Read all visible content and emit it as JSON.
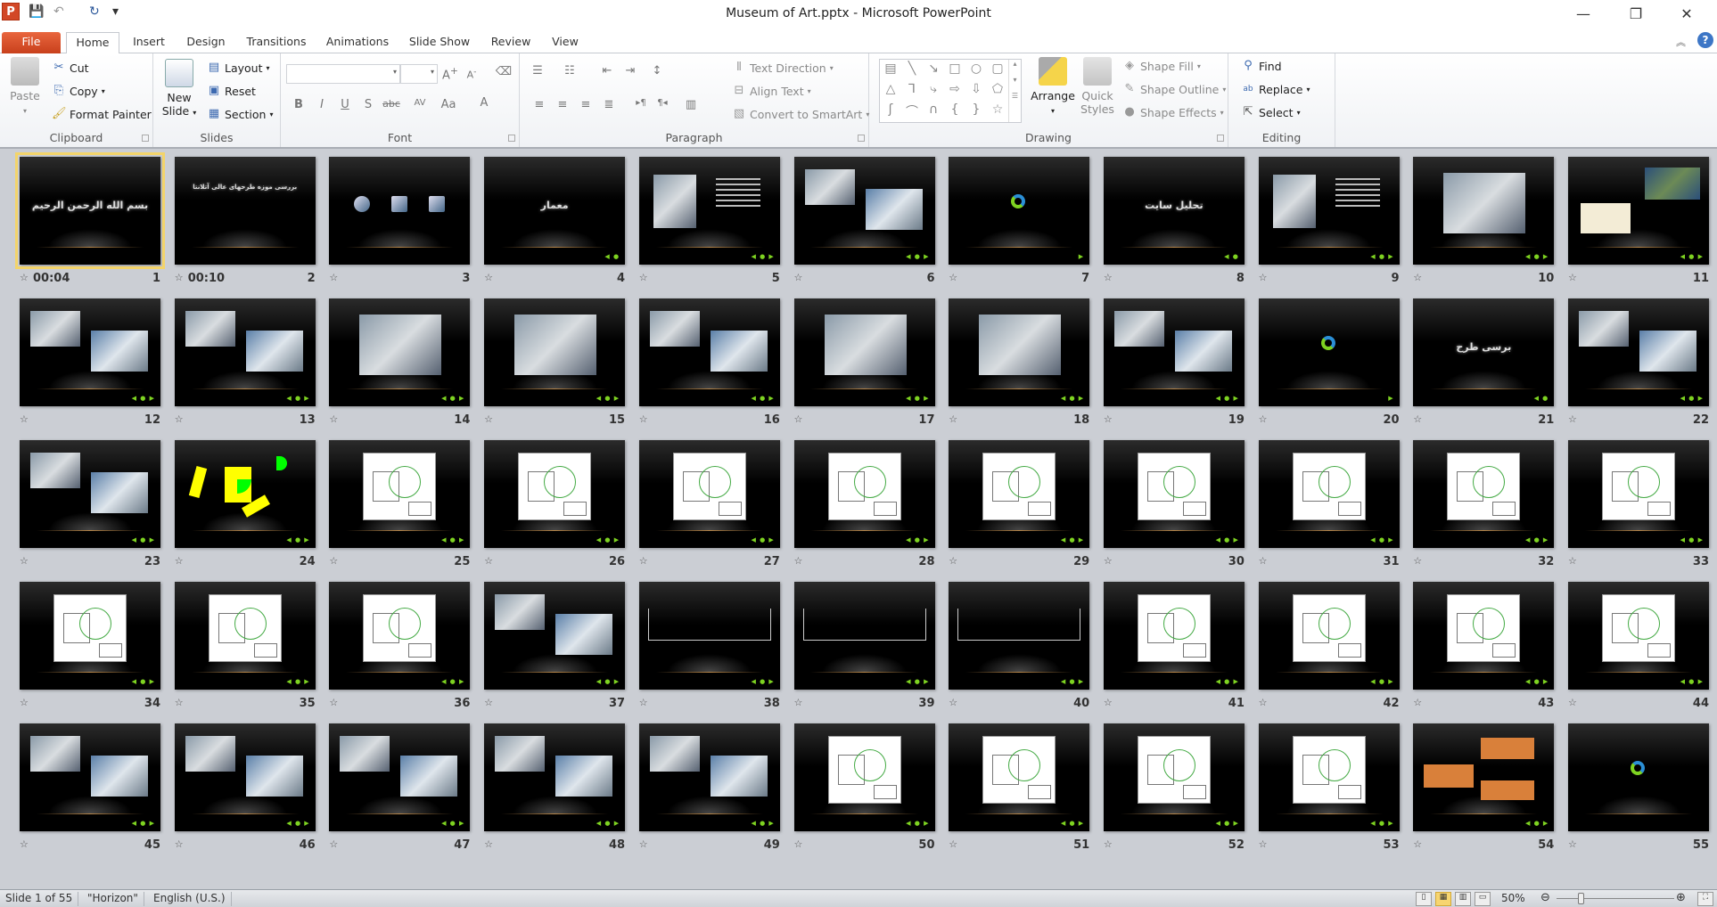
{
  "window": {
    "title": "Museum of Art.pptx - Microsoft PowerPoint",
    "minimize": "—",
    "restore": "❐",
    "close": "✕"
  },
  "qat": {
    "save": "save-icon",
    "undo": "undo-icon",
    "redo": "redo-icon",
    "customize": "▾"
  },
  "tabs": [
    {
      "label": "File"
    },
    {
      "label": "Home"
    },
    {
      "label": "Insert"
    },
    {
      "label": "Design"
    },
    {
      "label": "Transitions"
    },
    {
      "label": "Animations"
    },
    {
      "label": "Slide Show"
    },
    {
      "label": "Review"
    },
    {
      "label": "View"
    }
  ],
  "ribbon": {
    "clipboard": {
      "label": "Clipboard",
      "paste": "Paste",
      "cut": "Cut",
      "copy": "Copy",
      "format_painter": "Format Painter"
    },
    "slides": {
      "label": "Slides",
      "new_slide_1": "New",
      "new_slide_2": "Slide",
      "layout": "Layout",
      "reset": "Reset",
      "section": "Section"
    },
    "font": {
      "label": "Font",
      "font_name": "",
      "font_size": ""
    },
    "paragraph": {
      "label": "Paragraph",
      "text_direction": "Text Direction",
      "align_text": "Align Text",
      "convert_smartart": "Convert to SmartArt"
    },
    "drawing": {
      "label": "Drawing",
      "arrange": "Arrange",
      "quick_styles_1": "Quick",
      "quick_styles_2": "Styles",
      "shape_fill": "Shape Fill",
      "shape_outline": "Shape Outline",
      "shape_effects": "Shape Effects"
    },
    "editing": {
      "label": "Editing",
      "find": "Find",
      "replace": "Replace",
      "select": "Select"
    }
  },
  "selected_slide": 1,
  "accent": "#f3d46a",
  "slides": [
    {
      "n": "1",
      "time": "00:04",
      "kind": "title",
      "title": "بسم الله الرحمن الرحیم",
      "nav": ""
    },
    {
      "n": "2",
      "time": "00:10",
      "kind": "title-top",
      "title": "بررسی موزه طرحهای عالی آتلانتا",
      "nav": ""
    },
    {
      "n": "3",
      "time": "",
      "kind": "icons",
      "nav": ""
    },
    {
      "n": "4",
      "time": "",
      "kind": "title",
      "title": "معمار",
      "nav": "◀ ●"
    },
    {
      "n": "5",
      "time": "",
      "kind": "portrait",
      "nav": "◀ ● ▶"
    },
    {
      "n": "6",
      "time": "",
      "kind": "photos",
      "nav": "◀ ● ▶"
    },
    {
      "n": "7",
      "time": "",
      "kind": "arrows",
      "nav": "▶"
    },
    {
      "n": "8",
      "time": "",
      "kind": "title",
      "title": "تحلیل سایت",
      "nav": "◀ ●"
    },
    {
      "n": "9",
      "time": "",
      "kind": "portrait",
      "nav": "◀ ● ▶"
    },
    {
      "n": "10",
      "time": "",
      "kind": "photo",
      "nav": "◀ ● ▶"
    },
    {
      "n": "11",
      "time": "",
      "kind": "maps",
      "nav": "◀ ● ▶"
    },
    {
      "n": "12",
      "time": "",
      "kind": "photos",
      "nav": "◀ ● ▶"
    },
    {
      "n": "13",
      "time": "",
      "kind": "photos",
      "nav": "◀ ● ▶"
    },
    {
      "n": "14",
      "time": "",
      "kind": "photo",
      "nav": "◀ ● ▶"
    },
    {
      "n": "15",
      "time": "",
      "kind": "photo",
      "nav": "◀ ● ▶"
    },
    {
      "n": "16",
      "time": "",
      "kind": "photos",
      "nav": "◀ ● ▶"
    },
    {
      "n": "17",
      "time": "",
      "kind": "photo",
      "nav": "◀ ● ▶"
    },
    {
      "n": "18",
      "time": "",
      "kind": "photo",
      "nav": "◀ ● ▶"
    },
    {
      "n": "19",
      "time": "",
      "kind": "photos",
      "nav": "◀ ● ▶"
    },
    {
      "n": "20",
      "time": "",
      "kind": "arrows",
      "nav": "▶"
    },
    {
      "n": "21",
      "time": "",
      "kind": "title",
      "title": "برسی طرح",
      "nav": "◀ ●"
    },
    {
      "n": "22",
      "time": "",
      "kind": "photos",
      "nav": "◀ ● ▶"
    },
    {
      "n": "23",
      "time": "",
      "kind": "photos",
      "nav": "◀ ● ▶"
    },
    {
      "n": "24",
      "time": "",
      "kind": "shapes",
      "nav": "◀ ● ▶"
    },
    {
      "n": "25",
      "time": "",
      "kind": "plan",
      "nav": "◀ ● ▶"
    },
    {
      "n": "26",
      "time": "",
      "kind": "plan",
      "nav": "◀ ● ▶"
    },
    {
      "n": "27",
      "time": "",
      "kind": "plan",
      "nav": "◀ ● ▶"
    },
    {
      "n": "28",
      "time": "",
      "kind": "plan",
      "nav": "◀ ● ▶"
    },
    {
      "n": "29",
      "time": "",
      "kind": "plan",
      "nav": "◀ ● ▶"
    },
    {
      "n": "30",
      "time": "",
      "kind": "plan",
      "nav": "◀ ● ▶"
    },
    {
      "n": "31",
      "time": "",
      "kind": "plan",
      "nav": "◀ ● ▶"
    },
    {
      "n": "32",
      "time": "",
      "kind": "plan",
      "nav": "◀ ● ▶"
    },
    {
      "n": "33",
      "time": "",
      "kind": "plan",
      "nav": "◀ ● ▶"
    },
    {
      "n": "34",
      "time": "",
      "kind": "plan",
      "nav": "◀ ● ▶"
    },
    {
      "n": "35",
      "time": "",
      "kind": "plan",
      "nav": "◀ ● ▶"
    },
    {
      "n": "36",
      "time": "",
      "kind": "plan",
      "nav": "◀ ● ▶"
    },
    {
      "n": "37",
      "time": "",
      "kind": "photos",
      "nav": "◀ ● ▶"
    },
    {
      "n": "38",
      "time": "",
      "kind": "section",
      "nav": "◀ ● ▶"
    },
    {
      "n": "39",
      "time": "",
      "kind": "section",
      "nav": "◀ ● ▶"
    },
    {
      "n": "40",
      "time": "",
      "kind": "section",
      "nav": "◀ ● ▶"
    },
    {
      "n": "41",
      "time": "",
      "kind": "plan",
      "nav": "◀ ● ▶"
    },
    {
      "n": "42",
      "time": "",
      "kind": "plan",
      "nav": "◀ ● ▶"
    },
    {
      "n": "43",
      "time": "",
      "kind": "plan",
      "nav": "◀ ● ▶"
    },
    {
      "n": "44",
      "time": "",
      "kind": "plan",
      "nav": "◀ ● ▶"
    },
    {
      "n": "45",
      "time": "",
      "kind": "photos",
      "nav": "◀ ● ▶"
    },
    {
      "n": "46",
      "time": "",
      "kind": "photos",
      "nav": "◀ ● ▶"
    },
    {
      "n": "47",
      "time": "",
      "kind": "photos",
      "nav": "◀ ● ▶"
    },
    {
      "n": "48",
      "time": "",
      "kind": "photos",
      "nav": "◀ ● ▶"
    },
    {
      "n": "49",
      "time": "",
      "kind": "photos",
      "nav": "◀ ● ▶"
    },
    {
      "n": "50",
      "time": "",
      "kind": "plan",
      "nav": "◀ ● ▶"
    },
    {
      "n": "51",
      "time": "",
      "kind": "plan",
      "nav": "◀ ● ▶"
    },
    {
      "n": "52",
      "time": "",
      "kind": "plan",
      "nav": "◀ ● ▶"
    },
    {
      "n": "53",
      "time": "",
      "kind": "plan",
      "nav": "◀ ● ▶"
    },
    {
      "n": "54",
      "time": "",
      "kind": "orange",
      "nav": "◀ ● ▶"
    },
    {
      "n": "55",
      "time": "",
      "kind": "arrows",
      "nav": ""
    }
  ],
  "status": {
    "slide_info": "Slide 1 of 55",
    "theme": "\"Horizon\"",
    "language": "English (U.S.)",
    "zoom": "50%"
  }
}
